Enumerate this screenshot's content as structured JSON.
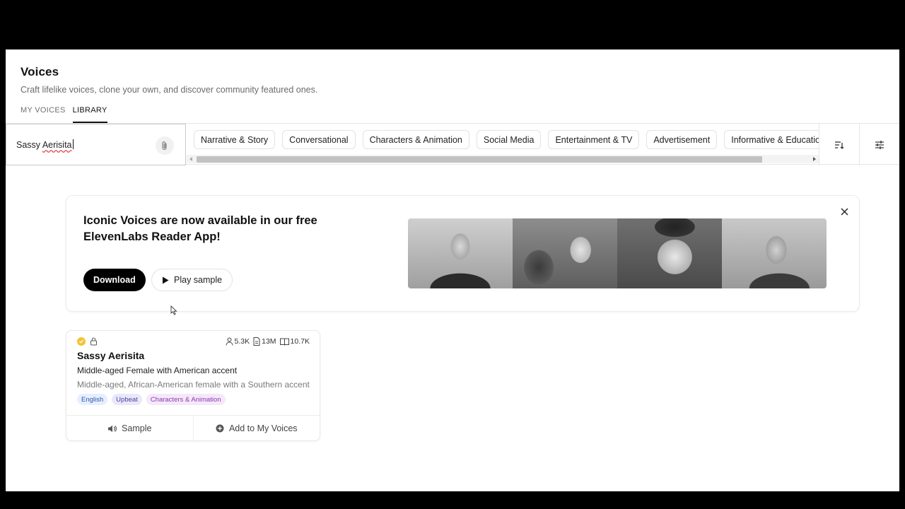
{
  "header": {
    "title": "Voices",
    "subtitle": "Craft lifelike voices, clone your own, and discover community featured ones."
  },
  "tabs": [
    {
      "label": "MY VOICES",
      "active": false
    },
    {
      "label": "LIBRARY",
      "active": true
    }
  ],
  "search": {
    "value_part1": "Sassy ",
    "value_part2": "Aerisita",
    "attach_icon": "paperclip-icon"
  },
  "categories": [
    "Narrative & Story",
    "Conversational",
    "Characters & Animation",
    "Social Media",
    "Entertainment & TV",
    "Advertisement",
    "Informative & Educational"
  ],
  "toolbar": {
    "sort_icon": "sort-icon",
    "filter_icon": "sliders-icon"
  },
  "banner": {
    "title": "Iconic Voices are now available in our free ElevenLabs Reader App!",
    "download_label": "Download",
    "play_label": "Play sample"
  },
  "voice": {
    "name": "Sassy Aerisita",
    "description": "Middle-aged Female with American accent",
    "long_description": "Middle-aged, African-American female with a Southern accent",
    "stats": {
      "users": "5.3K",
      "characters": "13M",
      "clones": "10.7K"
    },
    "tags": [
      "English",
      "Upbeat",
      "Characters & Animation"
    ],
    "sample_label": "Sample",
    "add_label": "Add to My Voices"
  },
  "colors": {
    "accent": "#000000",
    "verified": "#f2c432",
    "tag_english": "#e6efff",
    "tag_upbeat": "#e9e8fb",
    "tag_characters": "#f5e8fb"
  }
}
